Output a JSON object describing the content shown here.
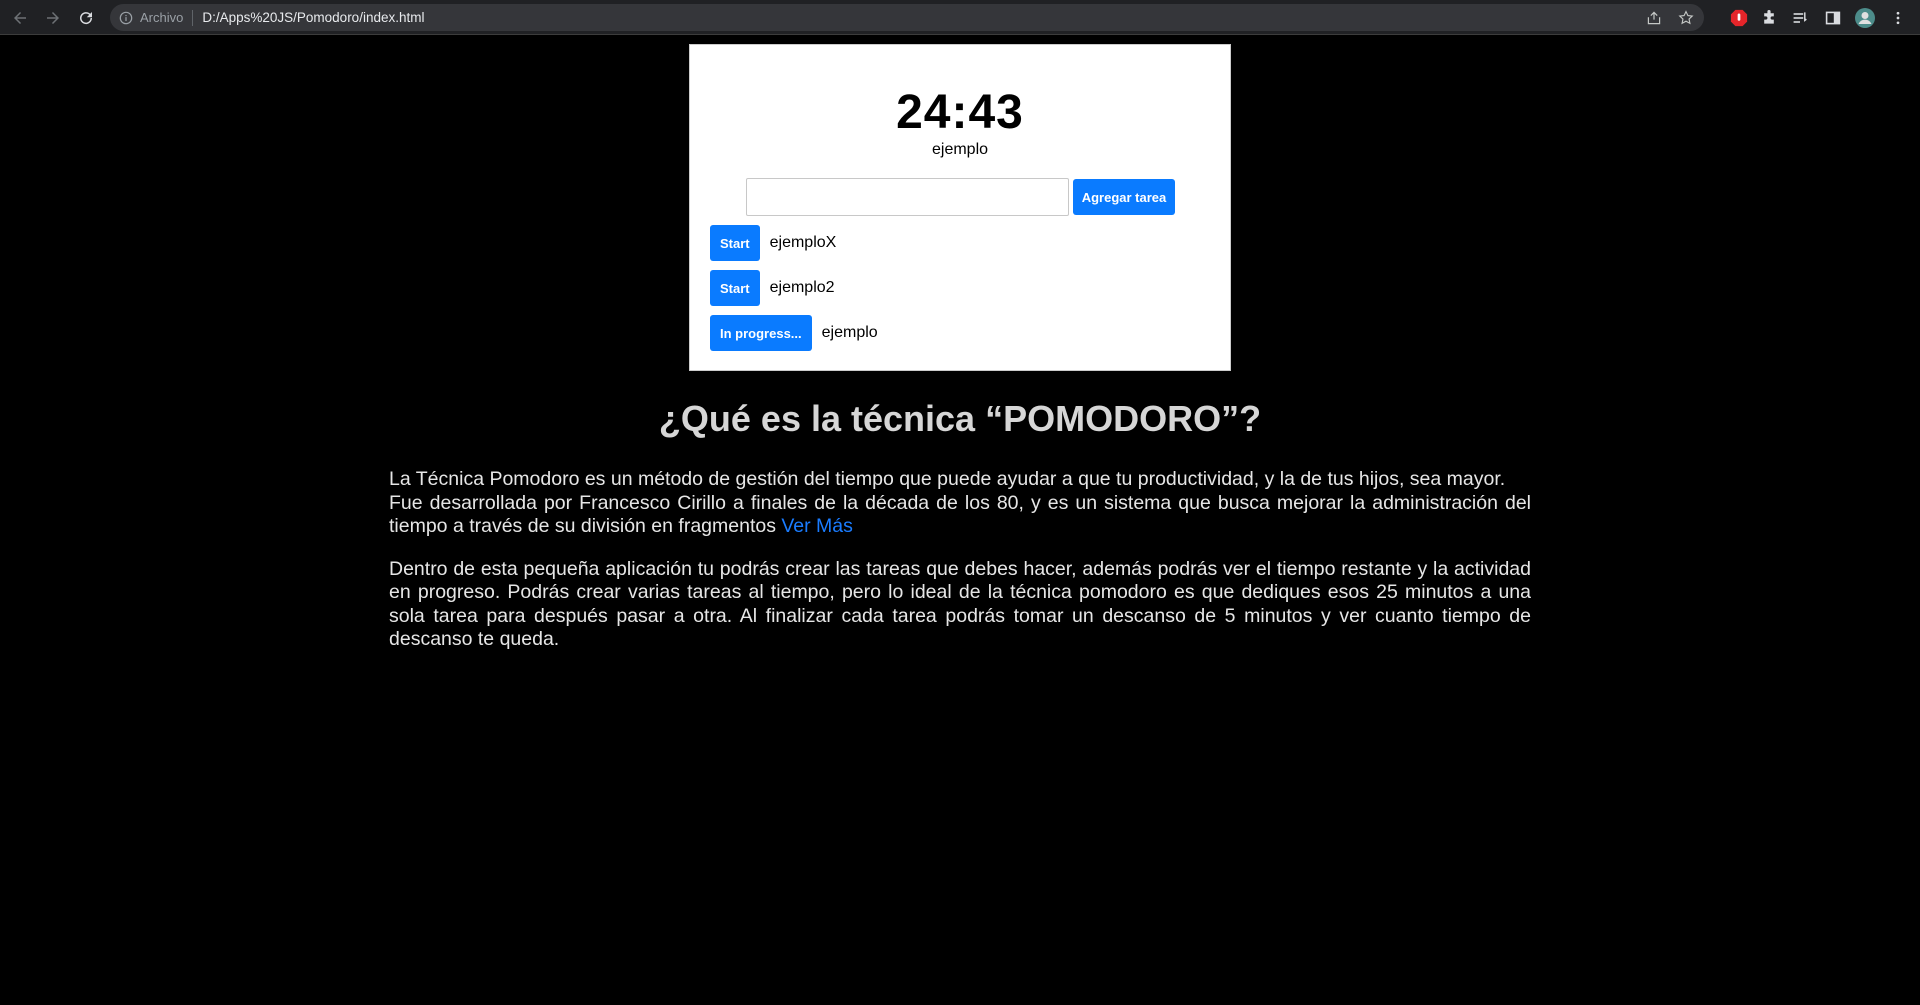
{
  "browser": {
    "chip": "Archivo",
    "url": "D:/Apps%20JS/Pomodoro/index.html"
  },
  "pomodoro": {
    "timer": "24:43",
    "current_task": "ejemplo",
    "input_value": "",
    "add_button": "Agregar tarea",
    "tasks": [
      {
        "button": "Start",
        "name": "ejemploX"
      },
      {
        "button": "Start",
        "name": "ejemplo2"
      },
      {
        "button": "In progress...",
        "name": "ejemplo"
      }
    ]
  },
  "article": {
    "title": "¿Qué es la técnica “POMODORO”?",
    "p1_line1": "La Técnica Pomodoro es un método de gestión del tiempo que puede ayudar a que tu productividad, y la de tus hijos, sea mayor.",
    "p1_line2": "Fue desarrollada por Francesco Cirillo a finales de la década de los 80, y es un sistema que busca mejorar la administración del tiempo a través de su división en fragmentos",
    "link": "Ver Más",
    "p2": "Dentro de esta pequeña aplicación tu podrás crear las tareas que debes hacer, además podrás ver el tiempo restante y la actividad en progreso. Podrás crear varias tareas al tiempo, pero lo ideal de la técnica pomodoro es que dediques esos 25 minutos a una sola tarea para después pasar a otra. Al finalizar cada tarea podrás tomar un descanso de 5 minutos y ver cuanto tiempo de descanso te queda."
  },
  "colors": {
    "accent": "#0a7bff",
    "page_bg": "#000000",
    "chrome_bg": "#202124"
  },
  "icons": [
    "back-icon",
    "forward-icon",
    "reload-icon",
    "info-icon",
    "share-icon",
    "star-icon",
    "adblock-icon",
    "extensions-icon",
    "reading-list-icon",
    "side-panel-icon",
    "profile-avatar",
    "menu-icon"
  ]
}
